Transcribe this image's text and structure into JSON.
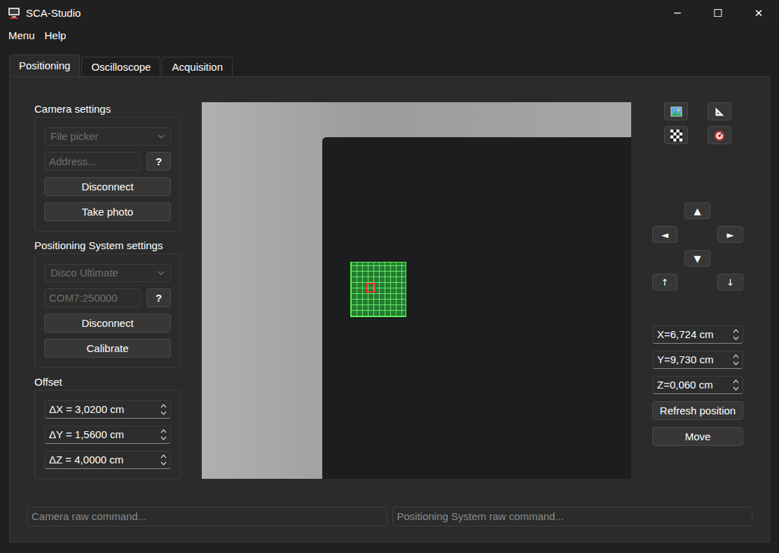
{
  "window": {
    "title": "SCA-Studio",
    "controls": [
      "─",
      "☐",
      "✕"
    ]
  },
  "menu": [
    "Menu",
    "Help"
  ],
  "tabs": [
    {
      "label": "Positioning",
      "selected": true
    },
    {
      "label": "Oscilloscope",
      "selected": false
    },
    {
      "label": "Acquisition",
      "selected": false
    }
  ],
  "camera_settings": {
    "title": "Camera settings",
    "source": {
      "value": "File picker",
      "disabled": true
    },
    "address": {
      "placeholder": "Address...",
      "disabled": true
    },
    "help": "?",
    "buttons": [
      "Disconnect",
      "Take photo"
    ]
  },
  "positioning_settings": {
    "title": "Positioning System settings",
    "source": {
      "value": "Disco Ultimate",
      "disabled": true
    },
    "port": {
      "value": "COM7:250000",
      "disabled": true
    },
    "help": "?",
    "buttons": [
      "Disconnect",
      "Calibrate"
    ]
  },
  "offset": {
    "title": "Offset",
    "fields": [
      "ΔX = 3,0200 cm",
      "ΔY = 1,5600 cm",
      "ΔZ = 4,0000 cm"
    ]
  },
  "jog": {
    "up": "▲",
    "left": "◄",
    "right": "►",
    "down": "▼",
    "z_up": "↑",
    "z_down": "↓"
  },
  "position": {
    "fields": [
      "X=6,724 cm",
      "Y=9,730 cm",
      "Z=0,060 cm"
    ],
    "buttons": [
      "Refresh position",
      "Move"
    ]
  },
  "raw_commands": {
    "camera": {
      "placeholder": "Camera raw command..."
    },
    "positioning": {
      "placeholder": "Positioning System raw command..."
    }
  }
}
